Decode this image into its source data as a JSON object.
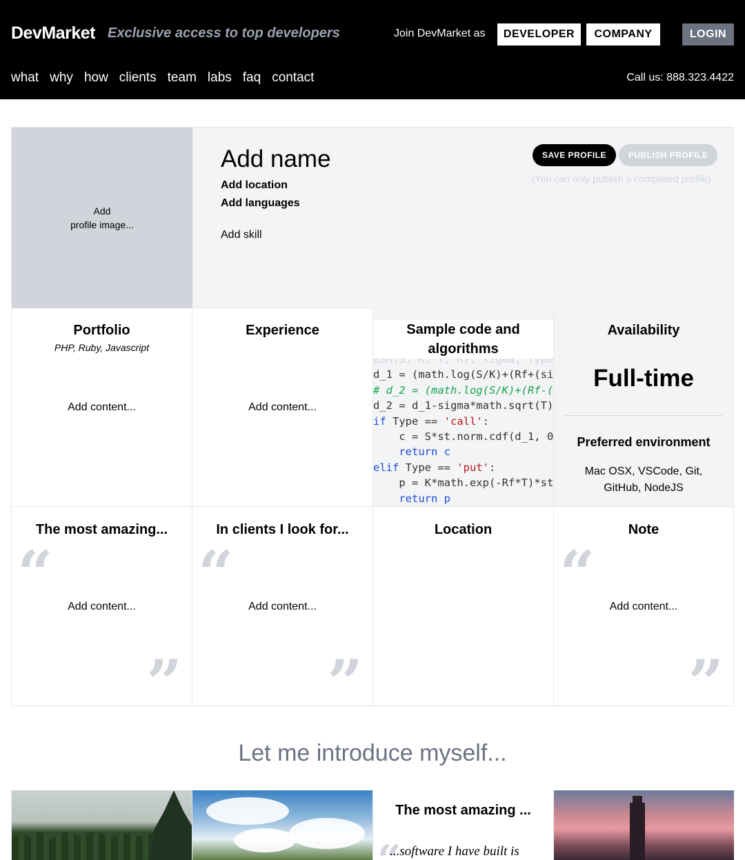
{
  "header": {
    "brand": "DevMarket",
    "tagline": "Exclusive access to top developers",
    "join_text": "Join DevMarket as",
    "developer_label": "DEVELOPER",
    "company_label": "COMPANY",
    "login_label": "LOGIN",
    "nav": [
      "what",
      "why",
      "how",
      "clients",
      "team",
      "labs",
      "faq",
      "contact"
    ],
    "call": "Call us: 888.323.4422"
  },
  "profile": {
    "image_line1": "Add",
    "image_line2": "profile image...",
    "name": "Add name",
    "location": "Add location",
    "languages": "Add languages",
    "skill": "Add skill",
    "save_label": "SAVE PROFILE",
    "publish_label": "PUBLISH PROFILE",
    "publish_note": "(You can only publish a completed profile)"
  },
  "cards": {
    "portfolio": {
      "title": "Portfolio",
      "subtitle": "PHP, Ruby, Javascript",
      "add": "Add content..."
    },
    "experience": {
      "title": "Experience",
      "add": "Add content..."
    },
    "code": {
      "title": "Sample code and algorithms",
      "lines": [
        "BSM(S, K, T, Rf, sigma, Type",
        "d_1 = (math.log(S/K)+(Rf+(si",
        "# d_2 = (math.log(S/K)+(Rf-(",
        "d_2 = d_1-sigma*math.sqrt(T)",
        "if Type == 'call':",
        "    c = S*st.norm.cdf(d_1, 0",
        "    return c",
        "elif Type == 'put':",
        "    p = K*math.exp(-Rf*T)*st",
        "    return p"
      ]
    },
    "availability": {
      "title": "Availability",
      "value": "Full-time",
      "pref_title": "Preferred environment",
      "pref_text": "Mac OSX, VSCode, Git, GitHub, NodeJS"
    },
    "amazing": {
      "title": "The most amazing...",
      "add": "Add content..."
    },
    "clients": {
      "title": "In clients I look for...",
      "add": "Add content..."
    },
    "location": {
      "title": "Location"
    },
    "note": {
      "title": "Note",
      "add": "Add content..."
    }
  },
  "intro": {
    "heading": "Let me introduce myself...",
    "card_title": "The most amazing ...",
    "card_text": "...software I have built is"
  },
  "colors": {
    "header_bg": "#000000",
    "muted": "#6b7280",
    "panel": "#f3f4f6",
    "placeholder": "#d1d5db"
  }
}
